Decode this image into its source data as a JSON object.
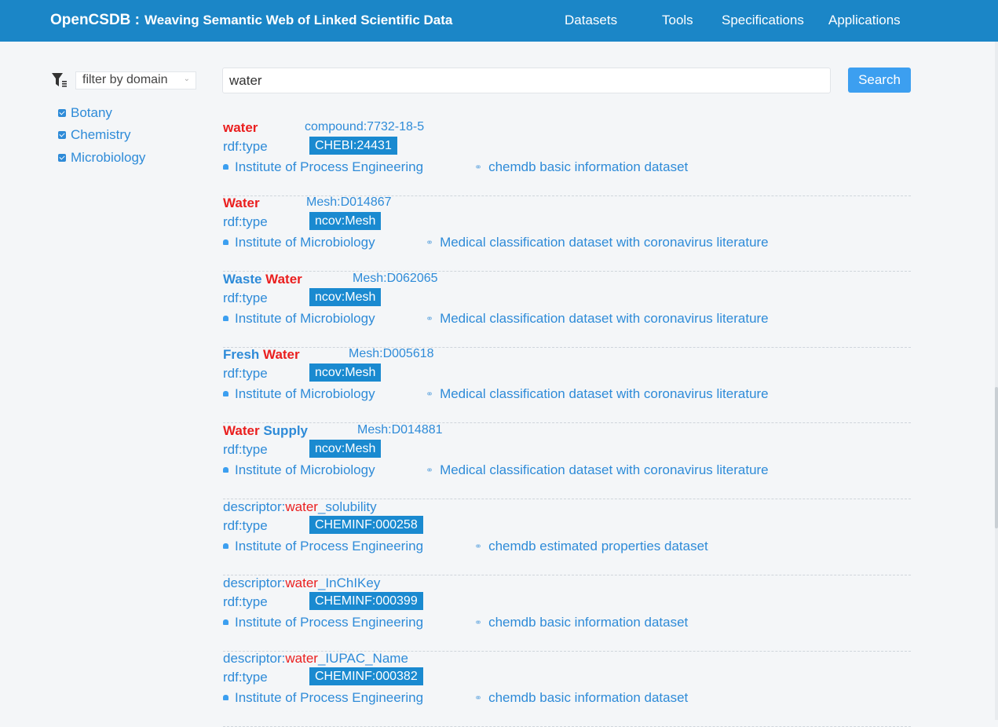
{
  "navbar": {
    "brand": "OpenCSDB :",
    "tagline": "Weaving Semantic Web of Linked Scientific Data",
    "links": [
      "Datasets",
      "Tools",
      "Specifications",
      "Applications"
    ]
  },
  "filter": {
    "icon": "filter-icon",
    "placeholder": "filter by domain",
    "domains": [
      {
        "label": "Botany",
        "checked": true
      },
      {
        "label": "Chemistry",
        "checked": true
      },
      {
        "label": "Microbiology",
        "checked": true
      }
    ]
  },
  "search": {
    "value": "water",
    "button": "Search"
  },
  "colors": {
    "navbar": "#1b86c7",
    "link": "#2e8bd8",
    "highlight": "#ea1f1f",
    "badge": "#1a8ad0",
    "button": "#3c9ff0"
  },
  "results": [
    {
      "title_parts": [
        {
          "text": "water",
          "style": "red bold"
        }
      ],
      "id": "compound:7732-18-5",
      "type_label": "rdf:type",
      "type_value": "CHEBI:24431",
      "institute": "Institute of Process Engineering",
      "dataset": "chemdb basic information dataset"
    },
    {
      "title_parts": [
        {
          "text": "Water",
          "style": "red bold"
        }
      ],
      "id": "Mesh:D014867",
      "type_label": "rdf:type",
      "type_value": "ncov:Mesh",
      "institute": "Institute of Microbiology",
      "dataset": "Medical classification dataset with coronavirus literature"
    },
    {
      "title_parts": [
        {
          "text": "Waste ",
          "style": "blue bold"
        },
        {
          "text": "Water",
          "style": "red bold"
        }
      ],
      "id": "Mesh:D062065",
      "type_label": "rdf:type",
      "type_value": "ncov:Mesh",
      "institute": "Institute of Microbiology",
      "dataset": "Medical classification dataset with coronavirus literature"
    },
    {
      "title_parts": [
        {
          "text": "Fresh ",
          "style": "blue bold"
        },
        {
          "text": "Water",
          "style": "red bold"
        }
      ],
      "id": "Mesh:D005618",
      "type_label": "rdf:type",
      "type_value": "ncov:Mesh",
      "institute": "Institute of Microbiology",
      "dataset": "Medical classification dataset with coronavirus literature"
    },
    {
      "title_parts": [
        {
          "text": "Water",
          "style": "red bold"
        },
        {
          "text": " Supply",
          "style": "blue bold"
        }
      ],
      "id": "Mesh:D014881",
      "type_label": "rdf:type",
      "type_value": "ncov:Mesh",
      "institute": "Institute of Microbiology",
      "dataset": "Medical classification dataset with coronavirus literature"
    },
    {
      "title_parts": [
        {
          "text": "descriptor:",
          "style": "blue"
        },
        {
          "text": "water",
          "style": "red"
        },
        {
          "text": "_solubility",
          "style": "blue"
        }
      ],
      "id": "",
      "type_label": "rdf:type",
      "type_value": "CHEMINF:000258",
      "institute": "Institute of Process Engineering",
      "dataset": "chemdb estimated properties dataset"
    },
    {
      "title_parts": [
        {
          "text": "descriptor:",
          "style": "blue"
        },
        {
          "text": "water",
          "style": "red"
        },
        {
          "text": "_InChIKey",
          "style": "blue"
        }
      ],
      "id": "",
      "type_label": "rdf:type",
      "type_value": "CHEMINF:000399",
      "institute": "Institute of Process Engineering",
      "dataset": "chemdb basic information dataset"
    },
    {
      "title_parts": [
        {
          "text": "descriptor:",
          "style": "blue"
        },
        {
          "text": "water",
          "style": "red"
        },
        {
          "text": "_IUPAC_Name",
          "style": "blue"
        }
      ],
      "id": "",
      "type_label": "rdf:type",
      "type_value": "CHEMINF:000382",
      "institute": "Institute of Process Engineering",
      "dataset": "chemdb basic information dataset"
    }
  ]
}
